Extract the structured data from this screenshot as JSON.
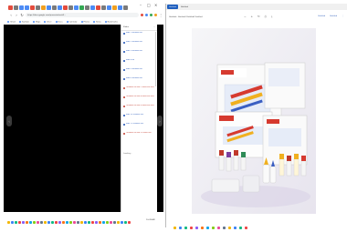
{
  "colors": {
    "video_bg": "#000000",
    "accent": "#1f5fbf",
    "link": "#1a4fb5",
    "taskbar_icons": [
      "#f2b705",
      "#3b82f6",
      "#10b981",
      "#ef4444",
      "#8b5cf6",
      "#f97316",
      "#0ea5e9",
      "#84cc16",
      "#ec4899",
      "#64748b"
    ]
  },
  "left_window": {
    "tab_favicons": [
      "#e34b3c",
      "#7a7a7a",
      "#4c8bf5",
      "#4c8bf5",
      "#e34b3c",
      "#7a7a7a",
      "#f0a020",
      "#4c8bf5",
      "#7a7a7a",
      "#4c8bf5",
      "#e34b3c",
      "#7a7a7a",
      "#4c8bf5",
      "#34a853",
      "#7a7a7a",
      "#4c8bf5",
      "#e34b3c",
      "#7a7a7a",
      "#4c8bf5",
      "#f0a020",
      "#4c8bf5",
      "#7a7a7a"
    ],
    "address": "https://docs.google.com/presentation/d/...",
    "bookmarks": [
      "Gmail",
      "YouTube",
      "Maps",
      "Drive",
      "Docs",
      "Calendar",
      "Photos",
      "News",
      "Bookmarks"
    ],
    "panel": {
      "title": "Slides",
      "items": [
        {
          "text": "Slide 1 (Untitled) link",
          "color": "#1a4fb5"
        },
        {
          "text": "Slide 2 (Untitled) link",
          "color": "#1a4fb5"
        },
        {
          "text": "Slide 3 (Untitled) link",
          "color": "#1a4fb5"
        },
        {
          "text": "Slide 4 link",
          "color": "#1a4fb5"
        },
        {
          "text": "Slide 5 (Untitled) link",
          "color": "#1a4fb5"
        },
        {
          "text": "Slide 6 (Untitled) link",
          "color": "#1a4fb5"
        },
        {
          "text": "Comment on slide 7 linked text here",
          "color": "#c0392b"
        },
        {
          "text": "Comment on slide 8 linked text here",
          "color": "#c0392b"
        },
        {
          "text": "Comment on slide 9 linked text here",
          "color": "#c0392b"
        },
        {
          "text": "Slide 10 (Untitled) link",
          "color": "#1a4fb5"
        },
        {
          "text": "Slide 11 (Untitled) link",
          "color": "#1a4fb5"
        },
        {
          "text": "Comment on slide 12 linked text",
          "color": "#c0392b"
        }
      ],
      "loading": "Loading..."
    },
    "clock": "10:28 AM"
  },
  "right_window": {
    "tabs": [
      "Untitled",
      "Untitled"
    ],
    "title": "Untitled - Untitled (Untitled) Untitled",
    "actions": [
      "Untitled",
      "Untitled"
    ]
  }
}
